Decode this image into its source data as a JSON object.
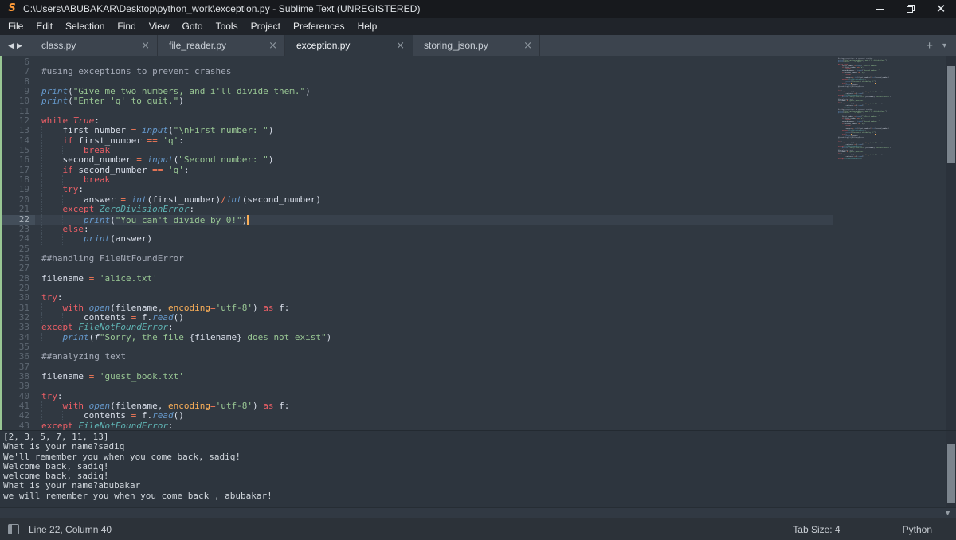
{
  "titlebar": {
    "logo_glyph": "S",
    "title": "C:\\Users\\ABUBAKAR\\Desktop\\python_work\\exception.py - Sublime Text (UNREGISTERED)"
  },
  "menu": {
    "items": [
      "File",
      "Edit",
      "Selection",
      "Find",
      "View",
      "Goto",
      "Tools",
      "Project",
      "Preferences",
      "Help"
    ]
  },
  "tabs": {
    "back_icon": "◀",
    "forward_icon": "▶",
    "close_icon": "×",
    "new_tab_icon": "+",
    "overflow_icon": "▾",
    "items": [
      {
        "label": "class.py",
        "active": false
      },
      {
        "label": "file_reader.py",
        "active": false
      },
      {
        "label": "exception.py",
        "active": true
      },
      {
        "label": "storing_json.py",
        "active": false
      }
    ]
  },
  "theme": {
    "editor_bg": "#303841",
    "keyword": "#ec5f66",
    "operator": "#f97b58",
    "function": "#6699cc",
    "class": "#5fb4b4",
    "string": "#99c794",
    "comment": "#a6acb9",
    "foreground": "#d8dee9",
    "caret": "#f9ae58",
    "diff_added": "#99c794"
  },
  "code": {
    "lines": [
      {
        "n": 6,
        "ind": 0,
        "tok": []
      },
      {
        "n": 7,
        "ind": 0,
        "tok": [
          [
            "c",
            "#using exceptions to prevent crashes"
          ]
        ]
      },
      {
        "n": 8,
        "ind": 0,
        "tok": []
      },
      {
        "n": 9,
        "ind": 0,
        "tok": [
          [
            "f",
            "print"
          ],
          [
            "p",
            "("
          ],
          [
            "s",
            "\"Give me two numbers, and i'll divide them.\""
          ],
          [
            "p",
            ")"
          ]
        ]
      },
      {
        "n": 10,
        "ind": 0,
        "tok": [
          [
            "f",
            "print"
          ],
          [
            "p",
            "("
          ],
          [
            "s",
            "\"Enter 'q' to quit.\""
          ],
          [
            "p",
            ")"
          ]
        ]
      },
      {
        "n": 11,
        "ind": 0,
        "tok": []
      },
      {
        "n": 12,
        "ind": 0,
        "tok": [
          [
            "k",
            "while"
          ],
          [
            "p",
            " "
          ],
          [
            "ki",
            "True"
          ],
          [
            "p",
            ":"
          ]
        ]
      },
      {
        "n": 13,
        "ind": 4,
        "tok": [
          [
            "p",
            "first_number "
          ],
          [
            "o",
            "="
          ],
          [
            "p",
            " "
          ],
          [
            "f",
            "input"
          ],
          [
            "p",
            "("
          ],
          [
            "s",
            "\"\\nFirst number: \""
          ],
          [
            "p",
            ")"
          ]
        ]
      },
      {
        "n": 14,
        "ind": 4,
        "tok": [
          [
            "k",
            "if"
          ],
          [
            "p",
            " first_number "
          ],
          [
            "o",
            "=="
          ],
          [
            "p",
            " "
          ],
          [
            "s",
            "'q'"
          ],
          [
            "p",
            ":"
          ]
        ]
      },
      {
        "n": 15,
        "ind": 8,
        "tok": [
          [
            "k",
            "break"
          ]
        ]
      },
      {
        "n": 16,
        "ind": 4,
        "tok": [
          [
            "p",
            "second_number "
          ],
          [
            "o",
            "="
          ],
          [
            "p",
            " "
          ],
          [
            "f",
            "input"
          ],
          [
            "p",
            "("
          ],
          [
            "s",
            "\"Second number: \""
          ],
          [
            "p",
            ")"
          ]
        ]
      },
      {
        "n": 17,
        "ind": 4,
        "tok": [
          [
            "k",
            "if"
          ],
          [
            "p",
            " second_number "
          ],
          [
            "o",
            "=="
          ],
          [
            "p",
            " "
          ],
          [
            "s",
            "'q'"
          ],
          [
            "p",
            ":"
          ]
        ]
      },
      {
        "n": 18,
        "ind": 8,
        "tok": [
          [
            "k",
            "break"
          ]
        ]
      },
      {
        "n": 19,
        "ind": 4,
        "tok": [
          [
            "k",
            "try"
          ],
          [
            "p",
            ":"
          ]
        ]
      },
      {
        "n": 20,
        "ind": 8,
        "tok": [
          [
            "p",
            "answer "
          ],
          [
            "o",
            "="
          ],
          [
            "p",
            " "
          ],
          [
            "f",
            "int"
          ],
          [
            "p",
            "(first_number)"
          ],
          [
            "o",
            "/"
          ],
          [
            "f",
            "int"
          ],
          [
            "p",
            "(second_number)"
          ]
        ]
      },
      {
        "n": 21,
        "ind": 4,
        "tok": [
          [
            "k",
            "except"
          ],
          [
            "p",
            " "
          ],
          [
            "t",
            "ZeroDivisionError"
          ],
          [
            "p",
            ":"
          ]
        ]
      },
      {
        "n": 22,
        "ind": 8,
        "hl": true,
        "cur": true,
        "tok": [
          [
            "f",
            "print"
          ],
          [
            "bm",
            "("
          ],
          [
            "s",
            "\"You can't divide by 0!\""
          ],
          [
            "bm",
            ")"
          ]
        ]
      },
      {
        "n": 23,
        "ind": 4,
        "tok": [
          [
            "k",
            "else"
          ],
          [
            "p",
            ":"
          ]
        ]
      },
      {
        "n": 24,
        "ind": 8,
        "tok": [
          [
            "f",
            "print"
          ],
          [
            "p",
            "(answer)"
          ]
        ]
      },
      {
        "n": 25,
        "ind": 0,
        "tok": []
      },
      {
        "n": 26,
        "ind": 0,
        "tok": [
          [
            "c",
            "##handling FileNtFoundError"
          ]
        ]
      },
      {
        "n": 27,
        "ind": 0,
        "tok": []
      },
      {
        "n": 28,
        "ind": 0,
        "tok": [
          [
            "p",
            "filename "
          ],
          [
            "o",
            "="
          ],
          [
            "p",
            " "
          ],
          [
            "s",
            "'alice.txt'"
          ]
        ]
      },
      {
        "n": 29,
        "ind": 0,
        "tok": []
      },
      {
        "n": 30,
        "ind": 0,
        "tok": [
          [
            "k",
            "try"
          ],
          [
            "p",
            ":"
          ]
        ]
      },
      {
        "n": 31,
        "ind": 4,
        "tok": [
          [
            "k",
            "with"
          ],
          [
            "p",
            " "
          ],
          [
            "f",
            "open"
          ],
          [
            "p",
            "(filename, "
          ],
          [
            "a",
            "encoding"
          ],
          [
            "o",
            "="
          ],
          [
            "s",
            "'utf-8'"
          ],
          [
            "p",
            ") "
          ],
          [
            "k",
            "as"
          ],
          [
            "p",
            " f:"
          ]
        ]
      },
      {
        "n": 32,
        "ind": 8,
        "tok": [
          [
            "p",
            "contents "
          ],
          [
            "o",
            "="
          ],
          [
            "p",
            " f."
          ],
          [
            "f",
            "read"
          ],
          [
            "p",
            "()"
          ]
        ]
      },
      {
        "n": 33,
        "ind": 0,
        "tok": [
          [
            "k",
            "except"
          ],
          [
            "p",
            " "
          ],
          [
            "t",
            "FileNotFoundError"
          ],
          [
            "p",
            ":"
          ]
        ]
      },
      {
        "n": 34,
        "ind": 4,
        "tok": [
          [
            "f",
            "print"
          ],
          [
            "p",
            "("
          ],
          [
            "fi",
            "f"
          ],
          [
            "s",
            "\"Sorry, the file "
          ],
          [
            "p",
            "{filename}"
          ],
          [
            "s",
            " does not exist\""
          ],
          [
            "p",
            ")"
          ]
        ]
      },
      {
        "n": 35,
        "ind": 0,
        "tok": []
      },
      {
        "n": 36,
        "ind": 0,
        "tok": [
          [
            "c",
            "##analyzing text"
          ]
        ]
      },
      {
        "n": 37,
        "ind": 0,
        "tok": []
      },
      {
        "n": 38,
        "ind": 0,
        "tok": [
          [
            "p",
            "filename "
          ],
          [
            "o",
            "="
          ],
          [
            "p",
            " "
          ],
          [
            "s",
            "'guest_book.txt'"
          ]
        ]
      },
      {
        "n": 39,
        "ind": 0,
        "tok": []
      },
      {
        "n": 40,
        "ind": 0,
        "tok": [
          [
            "k",
            "try"
          ],
          [
            "p",
            ":"
          ]
        ]
      },
      {
        "n": 41,
        "ind": 4,
        "tok": [
          [
            "k",
            "with"
          ],
          [
            "p",
            " "
          ],
          [
            "f",
            "open"
          ],
          [
            "p",
            "(filename, "
          ],
          [
            "a",
            "encoding"
          ],
          [
            "o",
            "="
          ],
          [
            "s",
            "'utf-8'"
          ],
          [
            "p",
            ") "
          ],
          [
            "k",
            "as"
          ],
          [
            "p",
            " f:"
          ]
        ]
      },
      {
        "n": 42,
        "ind": 8,
        "tok": [
          [
            "p",
            "contents "
          ],
          [
            "o",
            "="
          ],
          [
            "p",
            " f."
          ],
          [
            "f",
            "read"
          ],
          [
            "p",
            "()"
          ]
        ]
      },
      {
        "n": 43,
        "ind": 0,
        "tok": [
          [
            "k",
            "except"
          ],
          [
            "p",
            " "
          ],
          [
            "t",
            "FileNotFoundError"
          ],
          [
            "p",
            ":"
          ]
        ]
      }
    ]
  },
  "minimap": {
    "repeat": 2
  },
  "console": {
    "lines": [
      "[2, 3, 5, 7, 11, 13]",
      "What is your name?sadiq",
      "We'll remember you when you come back, sadiq!",
      "Welcome back, sadiq!",
      "welcome back, sadiq!",
      "What is your name?abubakar",
      "we will remember you when you come back , abubakar!"
    ],
    "scroll_down_icon": "▼"
  },
  "statusbar": {
    "position": "Line 22, Column 40",
    "tab_size": "Tab Size: 4",
    "syntax": "Python"
  }
}
